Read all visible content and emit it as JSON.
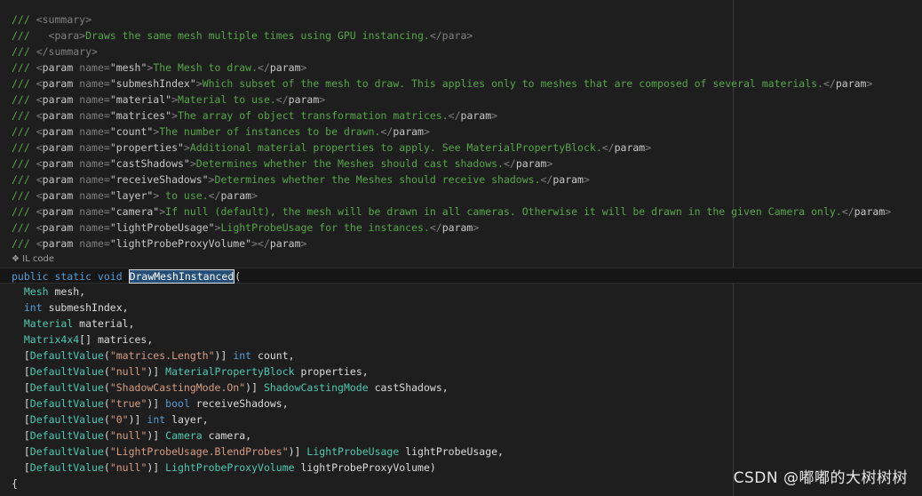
{
  "doc": {
    "summary_open": "<summary>",
    "para_open": "<para>",
    "para_text": "Draws the same mesh multiple times using GPU instancing.",
    "para_close": "</para>",
    "summary_close": "</summary>",
    "params": [
      {
        "name": "\"mesh\"",
        "text": "The Mesh to draw."
      },
      {
        "name": "\"submeshIndex\"",
        "text": "Which subset of the mesh to draw. This applies only to meshes that are composed of several materials."
      },
      {
        "name": "\"material\"",
        "text": "Material to use."
      },
      {
        "name": "\"matrices\"",
        "text": "The array of object transformation matrices."
      },
      {
        "name": "\"count\"",
        "text": "The number of instances to be drawn."
      },
      {
        "name": "\"properties\"",
        "text": "Additional material properties to apply. See MaterialPropertyBlock."
      },
      {
        "name": "\"castShadows\"",
        "text": "Determines whether the Meshes should cast shadows."
      },
      {
        "name": "\"receiveShadows\"",
        "text": "Determines whether the Meshes should receive shadows."
      },
      {
        "name": "\"layer\"",
        "text": " to use."
      },
      {
        "name": "\"camera\"",
        "text": "If null (default), the mesh will be drawn in all cameras. Otherwise it will be drawn in the given Camera only."
      },
      {
        "name": "\"lightProbeUsage\"",
        "text": "LightProbeUsage for the instances."
      },
      {
        "name": "\"lightProbeProxyVolume\"",
        "text": ""
      }
    ]
  },
  "codelens": {
    "icon": "❖",
    "label": "IL code"
  },
  "signature": {
    "modifiers": "public static void",
    "method": "DrawMeshInstanced",
    "open": "("
  },
  "args": [
    {
      "type": "Mesh",
      "name": " mesh,"
    },
    {
      "type": "int",
      "name": " submeshIndex,"
    },
    {
      "type": "Material",
      "name": " material,"
    },
    {
      "type": "Matrix4x4",
      "name": "[] matrices,"
    },
    {
      "attr": "DefaultValue",
      "value": "\"matrices.Length\"",
      "type": "int",
      "name": " count,"
    },
    {
      "attr": "DefaultValue",
      "value": "\"null\"",
      "type": "MaterialPropertyBlock",
      "name": " properties,"
    },
    {
      "attr": "DefaultValue",
      "value": "\"ShadowCastingMode.On\"",
      "type": "ShadowCastingMode",
      "name": " castShadows,"
    },
    {
      "attr": "DefaultValue",
      "value": "\"true\"",
      "type": "bool",
      "name": " receiveShadows,"
    },
    {
      "attr": "DefaultValue",
      "value": "\"0\"",
      "type": "int",
      "name": " layer,"
    },
    {
      "attr": "DefaultValue",
      "value": "\"null\"",
      "type": "Camera",
      "name": " camera,"
    },
    {
      "attr": "DefaultValue",
      "value": "\"LightProbeUsage.BlendProbes\"",
      "type": "LightProbeUsage",
      "name": " lightProbeUsage,"
    },
    {
      "attr": "DefaultValue",
      "value": "\"null\"",
      "type": "LightProbeProxyVolume",
      "name": " lightProbeProxyVolume)"
    }
  ],
  "body_open": "{",
  "watermark": "CSDN @嘟嘟的大树树树",
  "colors": {
    "background": "#1e1e1e",
    "comment": "#57a64a",
    "xml_tag": "#808080",
    "keyword": "#569cd6",
    "type": "#4ec9b0",
    "string": "#d69d85"
  }
}
